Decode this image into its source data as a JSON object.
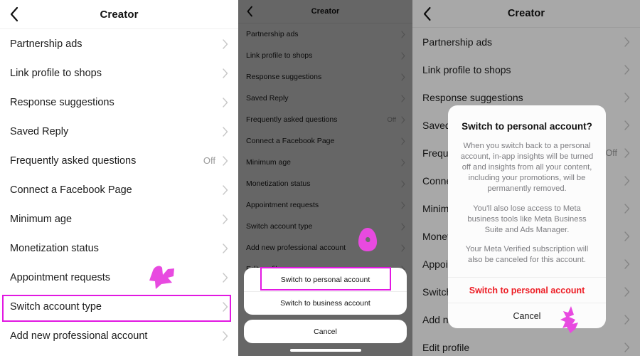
{
  "accent": {
    "highlight": "#e218e2",
    "marker": "#e84ae0",
    "danger": "#ed1c24"
  },
  "panel1": {
    "nav": {
      "back_icon": "chevron-left-icon",
      "title": "Creator"
    },
    "rows": [
      {
        "label": "Partnership ads",
        "value": ""
      },
      {
        "label": "Link profile to shops",
        "value": ""
      },
      {
        "label": "Response suggestions",
        "value": ""
      },
      {
        "label": "Saved Reply",
        "value": ""
      },
      {
        "label": "Frequently asked questions",
        "value": "Off"
      },
      {
        "label": "Connect a Facebook Page",
        "value": ""
      },
      {
        "label": "Minimum age",
        "value": ""
      },
      {
        "label": "Monetization status",
        "value": ""
      },
      {
        "label": "Appointment requests",
        "value": ""
      },
      {
        "label": "Switch account type",
        "value": ""
      },
      {
        "label": "Add new professional account",
        "value": ""
      }
    ],
    "highlighted_row_index": 9
  },
  "panel2": {
    "nav": {
      "back_icon": "chevron-left-icon",
      "title": "Creator"
    },
    "rows": [
      {
        "label": "Partnership ads",
        "value": ""
      },
      {
        "label": "Link profile to shops",
        "value": ""
      },
      {
        "label": "Response suggestions",
        "value": ""
      },
      {
        "label": "Saved Reply",
        "value": ""
      },
      {
        "label": "Frequently asked questions",
        "value": "Off"
      },
      {
        "label": "Connect a Facebook Page",
        "value": ""
      },
      {
        "label": "Minimum age",
        "value": ""
      },
      {
        "label": "Monetization status",
        "value": ""
      },
      {
        "label": "Appointment requests",
        "value": ""
      },
      {
        "label": "Switch account type",
        "value": ""
      },
      {
        "label": "Add new professional account",
        "value": ""
      },
      {
        "label": "Edit profile",
        "value": ""
      }
    ],
    "action_sheet": {
      "options": [
        "Switch to personal account",
        "Switch to business account"
      ],
      "cancel_label": "Cancel",
      "highlighted_option_index": 0
    }
  },
  "panel3": {
    "nav": {
      "back_icon": "chevron-left-icon",
      "title": "Creator"
    },
    "rows": [
      {
        "label": "Partnership ads",
        "value": ""
      },
      {
        "label": "Link profile to shops",
        "value": ""
      },
      {
        "label": "Response suggestions",
        "value": ""
      },
      {
        "label": "Saved",
        "value": ""
      },
      {
        "label": "Frequ",
        "value": "Off"
      },
      {
        "label": "Conne",
        "value": ""
      },
      {
        "label": "Minim",
        "value": ""
      },
      {
        "label": "Monet",
        "value": ""
      },
      {
        "label": "Appoi",
        "value": ""
      },
      {
        "label": "Switch",
        "value": ""
      },
      {
        "label": "Add ne",
        "value": ""
      },
      {
        "label": "Edit profile",
        "value": ""
      }
    ],
    "dialog": {
      "title": "Switch to personal account?",
      "paragraphs": [
        "When you switch back to a personal account, in-app insights will be turned off and insights from all your content, including your promotions, will be permanently removed.",
        "You'll also lose access to Meta business tools like Meta Business Suite and Ads Manager.",
        "Your Meta Verified subscription will also be canceled for this account."
      ],
      "confirm_label": "Switch to personal account",
      "cancel_label": "Cancel"
    }
  },
  "annotations": {
    "panel1_marker": "marker-arrow-scribble",
    "panel2_marker": "marker-blob-scribble",
    "panel3_marker": "marker-arrow-scribble"
  }
}
